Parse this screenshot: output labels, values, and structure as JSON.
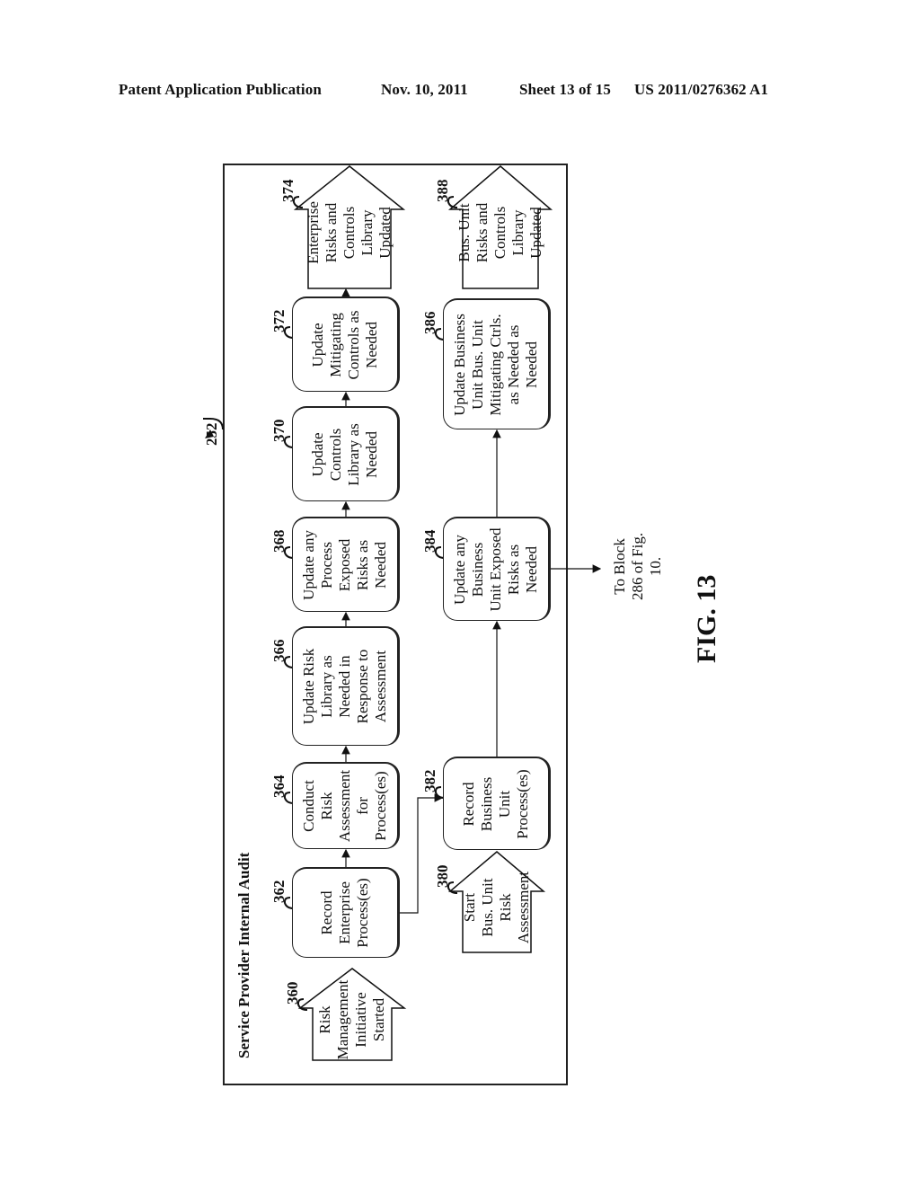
{
  "header": {
    "publication": "Patent Application Publication",
    "date": "Nov. 10, 2011",
    "sheet": "Sheet 13 of 15",
    "number": "US 2011/0276362 A1"
  },
  "diagram": {
    "ref_label": "252",
    "container_title": "Service Provider Internal Audit",
    "enterprise_row": [
      {
        "ref": "360",
        "type": "start-arrow",
        "text": "Risk\nManagement\nInitiative\nStarted"
      },
      {
        "ref": "362",
        "type": "process",
        "text": "Record\nEnterprise\nProcess(es)"
      },
      {
        "ref": "364",
        "type": "process",
        "text": "Conduct\nRisk\nAssessment\nfor\nProcess(es)"
      },
      {
        "ref": "366",
        "type": "process",
        "text": "Update Risk\nLibrary as\nNeeded in\nResponse to\nAssessment"
      },
      {
        "ref": "368",
        "type": "process",
        "text": "Update any\nProcess\nExposed\nRisks as\nNeeded"
      },
      {
        "ref": "370",
        "type": "process",
        "text": "Update\nControls\nLibrary as\nNeeded"
      },
      {
        "ref": "372",
        "type": "process",
        "text": "Update\nMitigating\nControls as\nNeeded"
      },
      {
        "ref": "374",
        "type": "end-arrow",
        "text": "Enterprise\nRisks and\nControls\nLibrary\nUpdated"
      }
    ],
    "business_unit_row": [
      {
        "ref": "380",
        "type": "start-arrow",
        "text": "Start\nBus. Unit\nRisk\nAssessment"
      },
      {
        "ref": "382",
        "type": "process",
        "text": "Record\nBusiness\nUnit\nProcess(es)"
      },
      {
        "ref": "384",
        "type": "process",
        "text": "Update any\nBusiness\nUnit Exposed\nRisks as\nNeeded"
      },
      {
        "ref": "386",
        "type": "process",
        "text": "Update Business\nUnit Bus. Unit\nMitigating Ctrls.\nas Needed as\nNeeded"
      },
      {
        "ref": "388",
        "type": "end-arrow",
        "text": "Bus. Unit\nRisks and\nControls\nLibrary\nUpdated"
      }
    ],
    "off_page": "To Block\n286 of Fig.\n10.",
    "figure_label": "FIG. 13"
  }
}
